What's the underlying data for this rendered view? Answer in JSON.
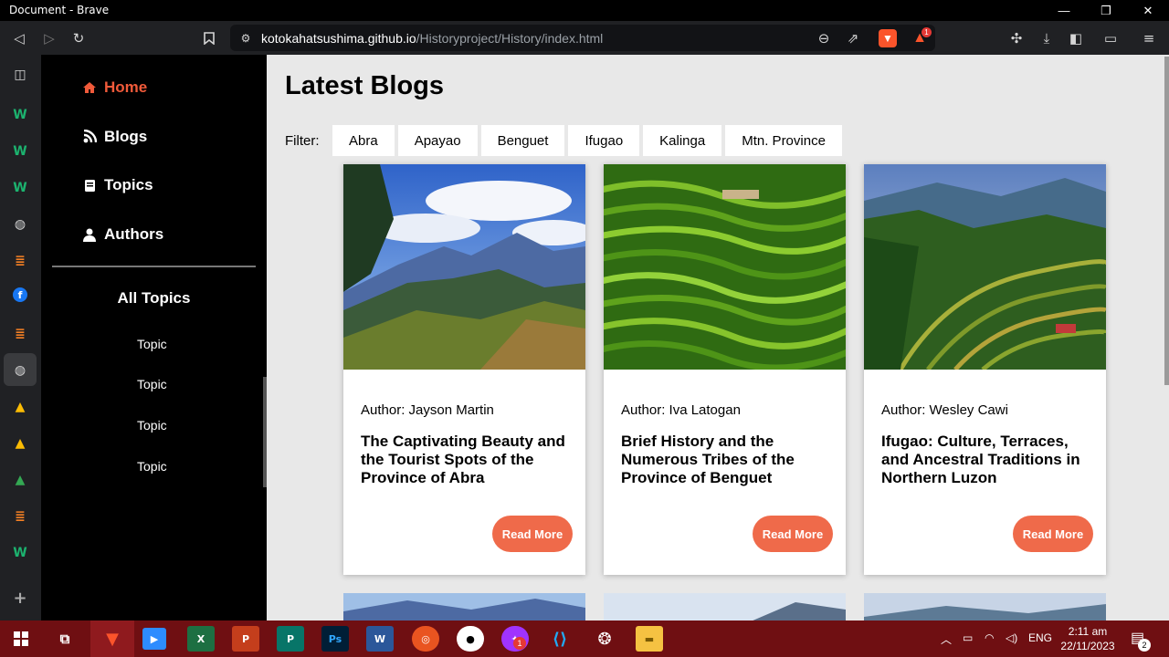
{
  "window": {
    "title": "Document - Brave",
    "minimize": "—",
    "restore": "❐",
    "close": "✕"
  },
  "browser": {
    "url_host": "kotokahatsushima.github.io",
    "url_path": "/Historyproject/History/index.html",
    "shield_badge": "1"
  },
  "nav": {
    "home": "Home",
    "blogs": "Blogs",
    "topics": "Topics",
    "authors": "Authors",
    "all_topics": "All Topics",
    "topic_items": [
      "Topic",
      "Topic",
      "Topic",
      "Topic"
    ]
  },
  "main": {
    "heading": "Latest Blogs",
    "filter_label": "Filter:",
    "filters": [
      "Abra",
      "Apayao",
      "Benguet",
      "Ifugao",
      "Kalinga",
      "Mtn. Province"
    ],
    "cards": [
      {
        "author": "Author: Jayson Martin",
        "title": "The Captivating Beauty and the Tourist Spots of the Province of Abra",
        "button": "Read More"
      },
      {
        "author": "Author: Iva Latogan",
        "title": "Brief History and the Numerous Tribes of the Province of Benguet",
        "button": "Read More"
      },
      {
        "author": "Author: Wesley Cawi",
        "title": "Ifugao: Culture, Terraces, and Ancestral Traditions in Northern Luzon",
        "button": "Read More"
      }
    ]
  },
  "taskbar": {
    "language": "ENG",
    "time": "2:11 am",
    "date": "22/11/2023",
    "notification_count": "2",
    "messenger_badge": "1"
  },
  "colors": {
    "accent": "#f05a3a",
    "button": "#ef6a4a",
    "taskbar": "#6f0f12"
  }
}
